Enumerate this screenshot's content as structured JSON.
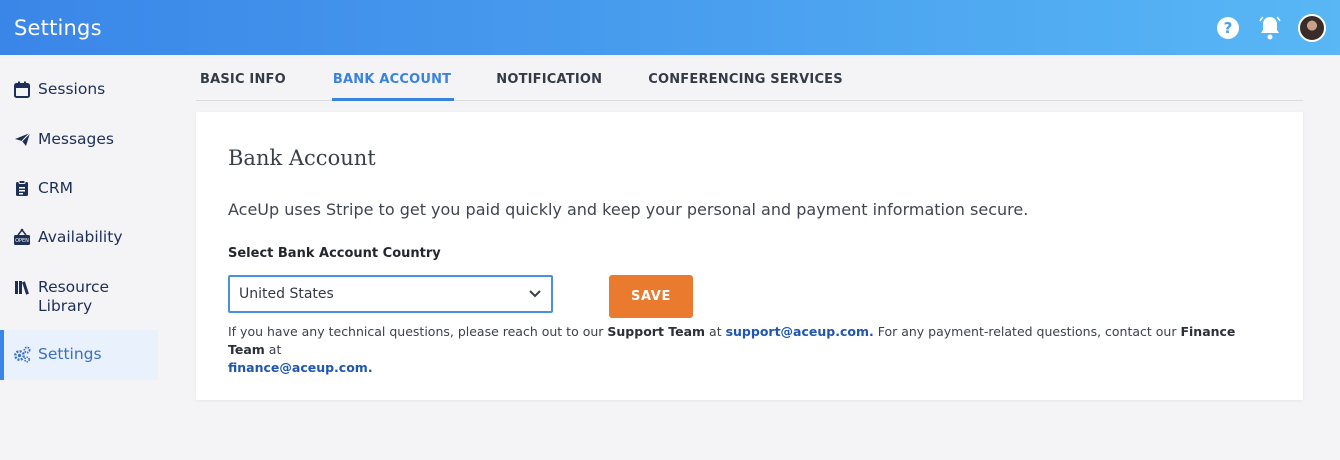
{
  "header": {
    "title": "Settings",
    "icons": [
      "help-icon",
      "bell-icon",
      "avatar"
    ]
  },
  "sidebar": {
    "items": [
      {
        "label": "Sessions",
        "icon": "calendar-icon"
      },
      {
        "label": "Messages",
        "icon": "paper-plane-icon"
      },
      {
        "label": "CRM",
        "icon": "clipboard-icon"
      },
      {
        "label": "Availability",
        "icon": "open-sign-icon"
      },
      {
        "label": "Resource Library",
        "icon": "books-icon"
      },
      {
        "label": "Settings",
        "icon": "gears-icon",
        "active": true
      }
    ]
  },
  "tabs": [
    {
      "label": "BASIC INFO"
    },
    {
      "label": "BANK ACCOUNT",
      "active": true
    },
    {
      "label": "NOTIFICATION"
    },
    {
      "label": "CONFERENCING SERVICES"
    }
  ],
  "card": {
    "title": "Bank Account",
    "description": "AceUp uses Stripe to get you paid quickly and keep your personal and payment information secure.",
    "field_label": "Select Bank Account Country",
    "select_value": "United States",
    "save_label": "SAVE",
    "help": {
      "part1": "If you have any technical questions, please reach out to our ",
      "support_team": "Support Team",
      "part2": " at ",
      "support_email": "support@aceup.com.",
      "part3": " For any payment-related questions, contact our ",
      "finance_team": "Finance Team",
      "part4": " at ",
      "finance_email": "finance@aceup.com."
    }
  },
  "colors": {
    "header_gradient_start": "#3a86e8",
    "header_gradient_end": "#58b7f5",
    "accent": "#3a82e0",
    "save_button": "#ea7a2d",
    "link": "#1f56b3"
  }
}
